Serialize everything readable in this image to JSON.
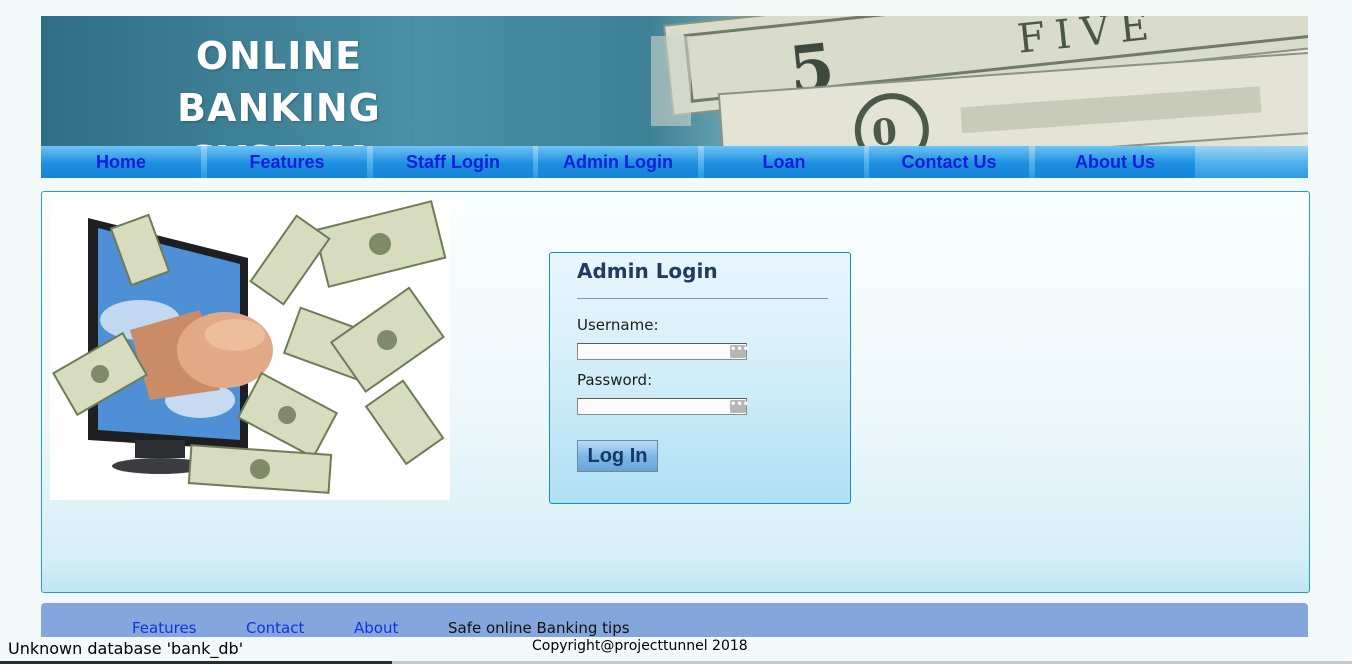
{
  "banner": {
    "title_line1": "ONLINE BANKING",
    "title_line2": "SYSTEM",
    "image": "dollar-bills-banner"
  },
  "nav": {
    "items": [
      {
        "label": "Home"
      },
      {
        "label": "Features"
      },
      {
        "label": "Staff Login"
      },
      {
        "label": "Admin Login"
      },
      {
        "label": "Loan"
      },
      {
        "label": "Contact Us"
      },
      {
        "label": "About Us"
      }
    ]
  },
  "hero": {
    "image": "money-flying-from-monitor-illustration"
  },
  "login": {
    "title": "Admin Login",
    "username_label": "Username:",
    "username_value": "",
    "password_label": "Password:",
    "password_value": "",
    "field_icon": "password-manager-key-icon",
    "button_label": "Log In"
  },
  "footer": {
    "links": [
      {
        "label": "Features"
      },
      {
        "label": "Contact"
      },
      {
        "label": "About"
      }
    ],
    "tips": "Safe online Banking tips",
    "copyright": "Copyright@projecttunnel 2018"
  },
  "error": "Unknown database 'bank_db'",
  "colors": {
    "nav_text": "#0d1fd8",
    "footer_bg": "#84a6dc",
    "login_border": "#1592c2",
    "content_border": "#1fa0c6"
  }
}
